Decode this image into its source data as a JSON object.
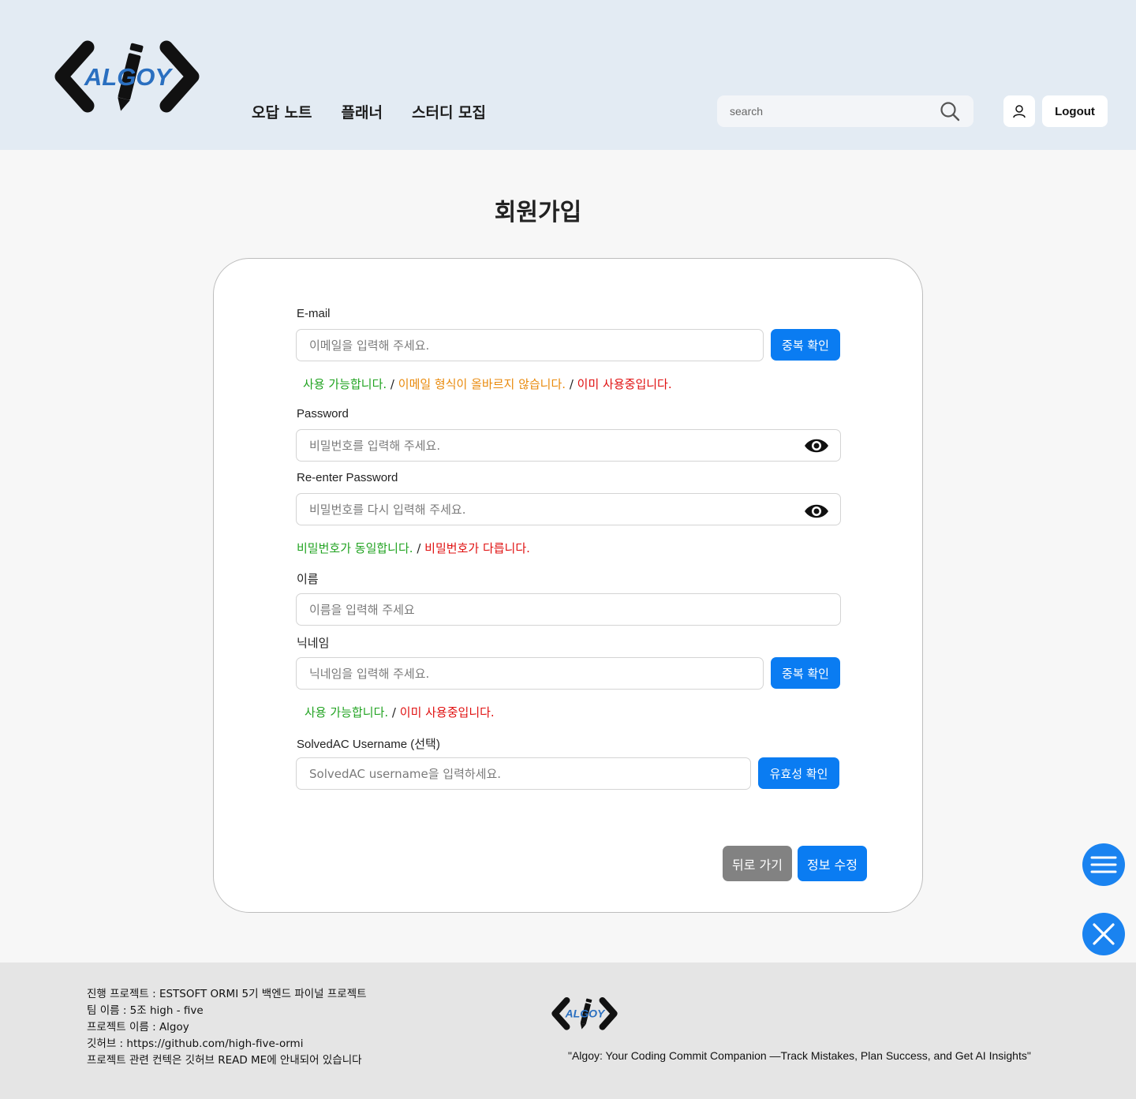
{
  "brand": {
    "logo_text": "ALGOY",
    "accent": "#2a6fc0"
  },
  "nav": {
    "items": [
      "오답 노트",
      "플래너",
      "스터디 모집"
    ]
  },
  "header": {
    "search_placeholder": "search",
    "logout_label": "Logout"
  },
  "page": {
    "title": "회원가입"
  },
  "form": {
    "email": {
      "label": "E-mail",
      "placeholder": "이메일을 입력해 주세요.",
      "check_label": "중복 확인",
      "msg_ok": "사용 가능합니다.",
      "msg_warn": "이메일 형식이 올바르지 않습니다.",
      "msg_err": "이미 사용중입니다."
    },
    "password": {
      "label": "Password",
      "placeholder": "비밀번호를 입력해 주세요."
    },
    "password_confirm": {
      "label": "Re-enter Password",
      "placeholder": "비밀번호를 다시 입력해 주세요.",
      "msg_ok": "비밀번호가 동일합니다.",
      "msg_err": "비밀번호가 다릅니다."
    },
    "name": {
      "label": "이름",
      "placeholder": "이름을 입력해 주세요"
    },
    "nickname": {
      "label": "닉네임",
      "placeholder": "닉네임을 입력해 주세요.",
      "check_label": "중복 확인",
      "msg_ok": "사용 가능합니다.",
      "msg_err": "이미 사용중입니다."
    },
    "solvedac": {
      "label": "SolvedAC Username (선택)",
      "placeholder": "SolvedAC username을 입력하세요.",
      "check_label": "유효성 확인"
    },
    "separator": "/",
    "back_label": "뒤로 가기",
    "submit_label": "정보 수정"
  },
  "colors": {
    "primary": "#0a7cf2",
    "ok": "#21a321",
    "warn": "#e98a0c",
    "error": "#e01010",
    "header_bg": "#e3ebf3",
    "footer_bg": "#e5e5e5"
  },
  "fabs": {
    "menu_icon": "hamburger-icon",
    "close_icon": "close-icon"
  },
  "footer": {
    "lines": [
      "진행 프로젝트 : ESTSOFT ORMI 5기 백엔드 파이널 프로젝트",
      "팀 이름 : 5조 high - five",
      "프로젝트 이름 : Algoy",
      "깃허브 : https://github.com/high-five-ormi",
      "프로젝트 관련 컨텍은 깃허브 READ ME에 안내되어 있습니다"
    ],
    "slogan": "\"Algoy: Your Coding Commit Companion —Track Mistakes, Plan Success, and Get AI Insights\""
  }
}
